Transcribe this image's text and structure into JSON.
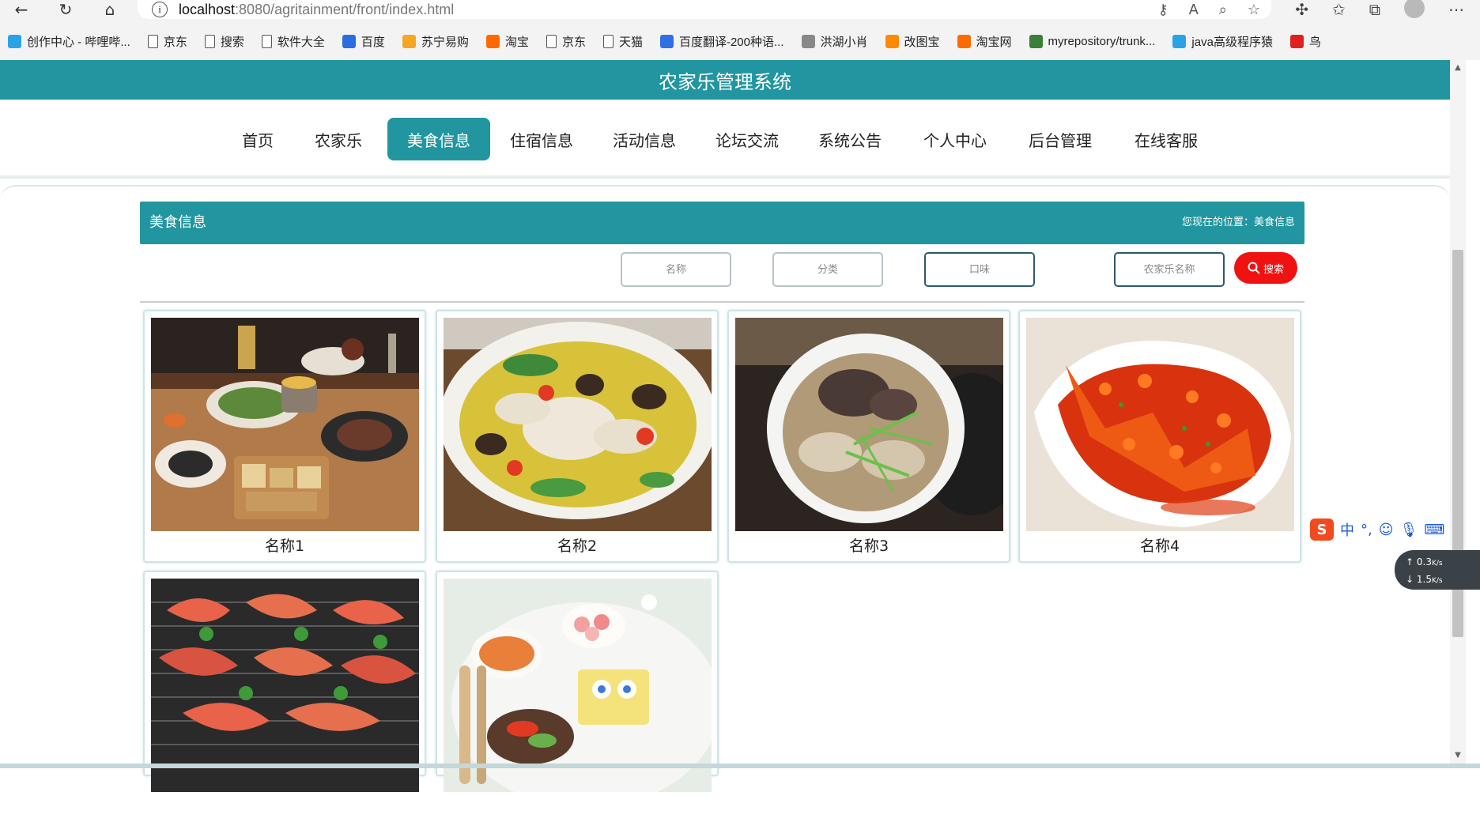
{
  "browser": {
    "address_host": "localhost",
    "address_path": ":8080/agritainment/front/index.html",
    "bookmarks": [
      {
        "label": "创作中心 - 哔哩哔...",
        "icon": "bilibili-icon",
        "color": "#2aa3e6"
      },
      {
        "label": "京东",
        "icon": "page-icon"
      },
      {
        "label": "搜索",
        "icon": "page-icon"
      },
      {
        "label": "软件大全",
        "icon": "page-icon"
      },
      {
        "label": "百度",
        "icon": "baidu-paw-icon",
        "color": "#2b6de0"
      },
      {
        "label": "苏宁易购",
        "icon": "suning-icon",
        "color": "#f6a623"
      },
      {
        "label": "淘宝",
        "icon": "taobao-icon",
        "color": "#ff6a00"
      },
      {
        "label": "京东",
        "icon": "page-icon"
      },
      {
        "label": "天猫",
        "icon": "page-icon"
      },
      {
        "label": "百度翻译-200种语...",
        "icon": "translate-icon",
        "color": "#2f6fe4"
      },
      {
        "label": "洪湖小肖",
        "icon": "avatar-icon",
        "color": "#888888"
      },
      {
        "label": "改图宝",
        "icon": "gaitubao-icon",
        "color": "#ff8a00"
      },
      {
        "label": "淘宝网",
        "icon": "taobao-icon",
        "color": "#ff6a00"
      },
      {
        "label": "myrepository/trunk...",
        "icon": "chrome-icon",
        "color": "#3a7f3a"
      },
      {
        "label": "java高级程序猿",
        "icon": "bilibili-icon",
        "color": "#2aa3e6"
      },
      {
        "label": "鸟",
        "icon": "bird-icon",
        "color": "#e02020"
      }
    ]
  },
  "site": {
    "title": "农家乐管理系统",
    "nav": [
      "首页",
      "农家乐",
      "美食信息",
      "住宿信息",
      "活动信息",
      "论坛交流",
      "系统公告",
      "个人中心",
      "后台管理",
      "在线客服"
    ],
    "active_nav": "美食信息"
  },
  "section": {
    "title": "美食信息",
    "location": "您现在的位置：美食信息"
  },
  "filters": {
    "name_placeholder": "名称",
    "category_placeholder": "分类",
    "taste_placeholder": "口味",
    "farm_placeholder": "农家乐名称",
    "search_label": "搜索"
  },
  "items": [
    {
      "name": "名称1"
    },
    {
      "name": "名称2"
    },
    {
      "name": "名称3"
    },
    {
      "name": "名称4"
    },
    {
      "name": ""
    },
    {
      "name": ""
    }
  ],
  "ime": {
    "label": "中",
    "punct": "°,"
  },
  "netspeed": {
    "up": "0.3",
    "down": "1.5",
    "unit": "K/s"
  },
  "colors": {
    "brand": "#2196a0",
    "search": "#f01111"
  }
}
